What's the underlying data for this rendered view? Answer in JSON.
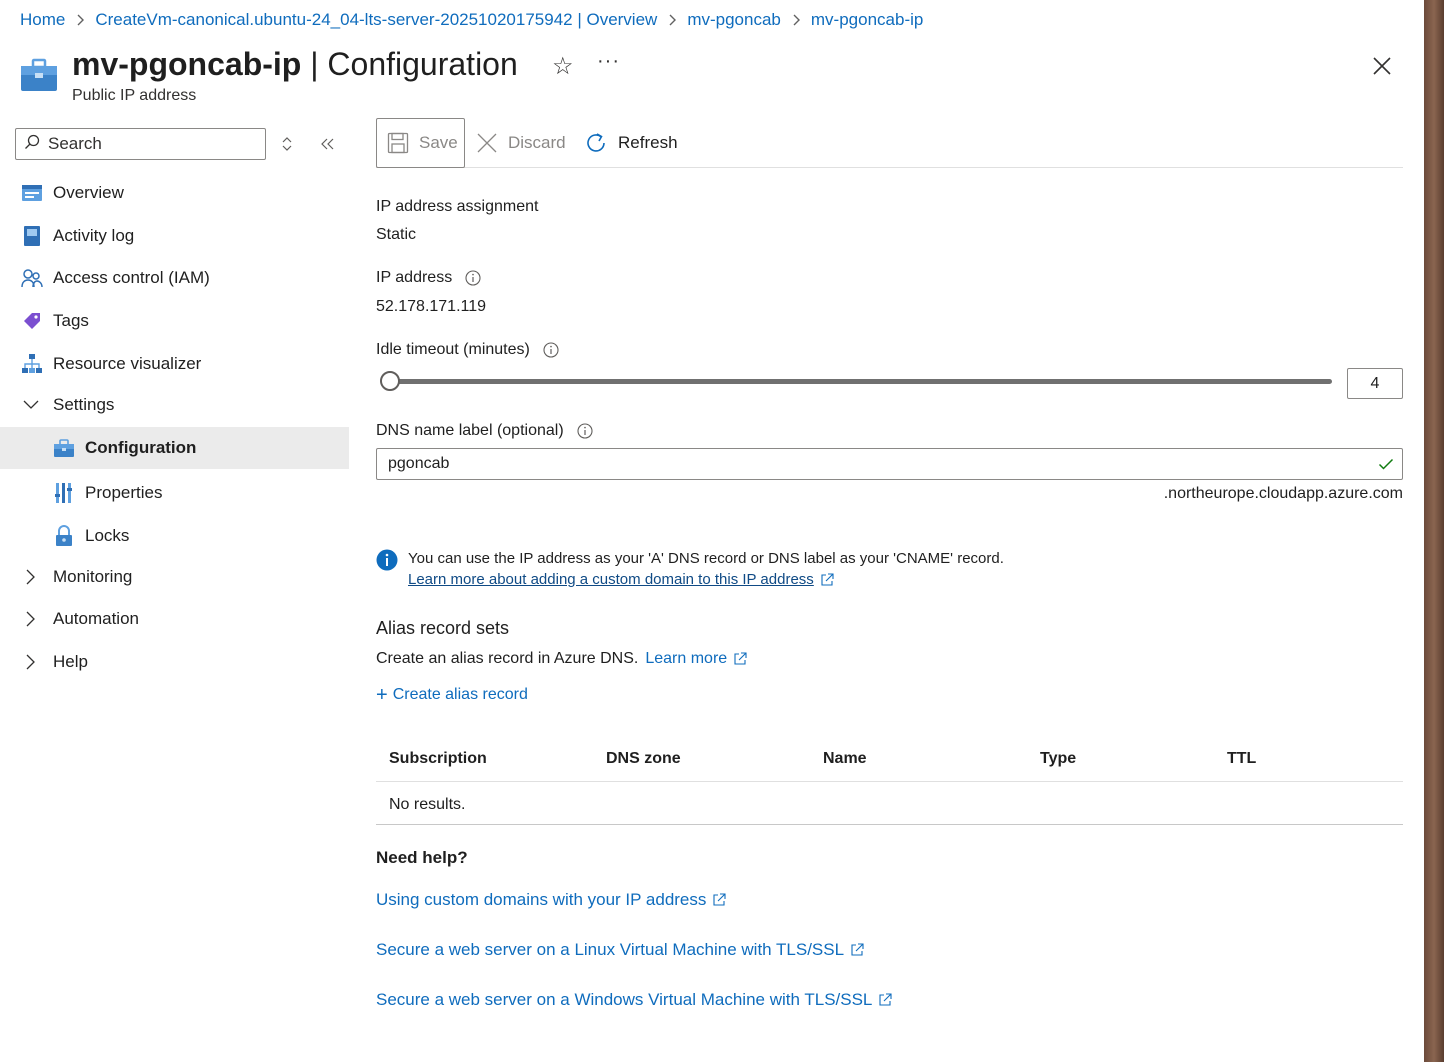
{
  "breadcrumb": [
    "Home",
    "CreateVm-canonical.ubuntu-24_04-lts-server-20251020175942 | Overview",
    "mv-pgoncab",
    "mv-pgoncab-ip"
  ],
  "header": {
    "resource_name": "mv-pgoncab-ip",
    "page_title": " | Configuration",
    "subtitle": "Public IP address",
    "more": "···"
  },
  "sidebar": {
    "search_placeholder": "Search",
    "items": [
      {
        "label": "Overview",
        "icon": "overview-icon"
      },
      {
        "label": "Activity log",
        "icon": "activity-log-icon"
      },
      {
        "label": "Access control (IAM)",
        "icon": "iam-icon"
      },
      {
        "label": "Tags",
        "icon": "tag-icon"
      },
      {
        "label": "Resource visualizer",
        "icon": "visualizer-icon"
      },
      {
        "label": "Settings",
        "icon": "chevron-down-icon"
      },
      {
        "label": "Configuration",
        "icon": "configuration-icon",
        "active": true
      },
      {
        "label": "Properties",
        "icon": "properties-icon"
      },
      {
        "label": "Locks",
        "icon": "lock-icon"
      },
      {
        "label": "Monitoring",
        "icon": "chevron-right-icon"
      },
      {
        "label": "Automation",
        "icon": "chevron-right-icon"
      },
      {
        "label": "Help",
        "icon": "chevron-right-icon"
      }
    ]
  },
  "toolbar": {
    "save_label": "Save",
    "discard_label": "Discard",
    "refresh_label": "Refresh"
  },
  "form": {
    "ip_assignment_label": "IP address assignment",
    "ip_assignment_value": "Static",
    "ip_address_label": "IP address",
    "ip_address_value": "52.178.171.119",
    "idle_timeout_label": "Idle timeout (minutes)",
    "idle_timeout_value": "4",
    "idle_timeout_min": 4,
    "idle_timeout_max": 30,
    "dns_label": "DNS name label (optional)",
    "dns_value": "pgoncab",
    "dns_suffix": ".northeurope.cloudapp.azure.com"
  },
  "info": {
    "message": "You can use the IP address as your 'A' DNS record or DNS label as your 'CNAME' record.",
    "link": "Learn more about adding a custom domain to this IP address"
  },
  "alias": {
    "title": "Alias record sets",
    "description": "Create an alias record in Azure DNS.",
    "learn_more": "Learn more",
    "create_label": "Create alias record"
  },
  "table": {
    "columns": [
      "Subscription",
      "DNS zone",
      "Name",
      "Type",
      "TTL"
    ],
    "empty_text": "No results."
  },
  "help": {
    "title": "Need help?",
    "links": [
      "Using custom domains with your IP address",
      "Secure a web server on a Linux Virtual Machine with TLS/SSL",
      "Secure a web server on a Windows Virtual Machine with TLS/SSL"
    ]
  },
  "colors": {
    "link": "#0f6cbd",
    "active_nav": "#ebebeb",
    "success_check": "#107c10",
    "info_blue": "#0f6cbd"
  }
}
